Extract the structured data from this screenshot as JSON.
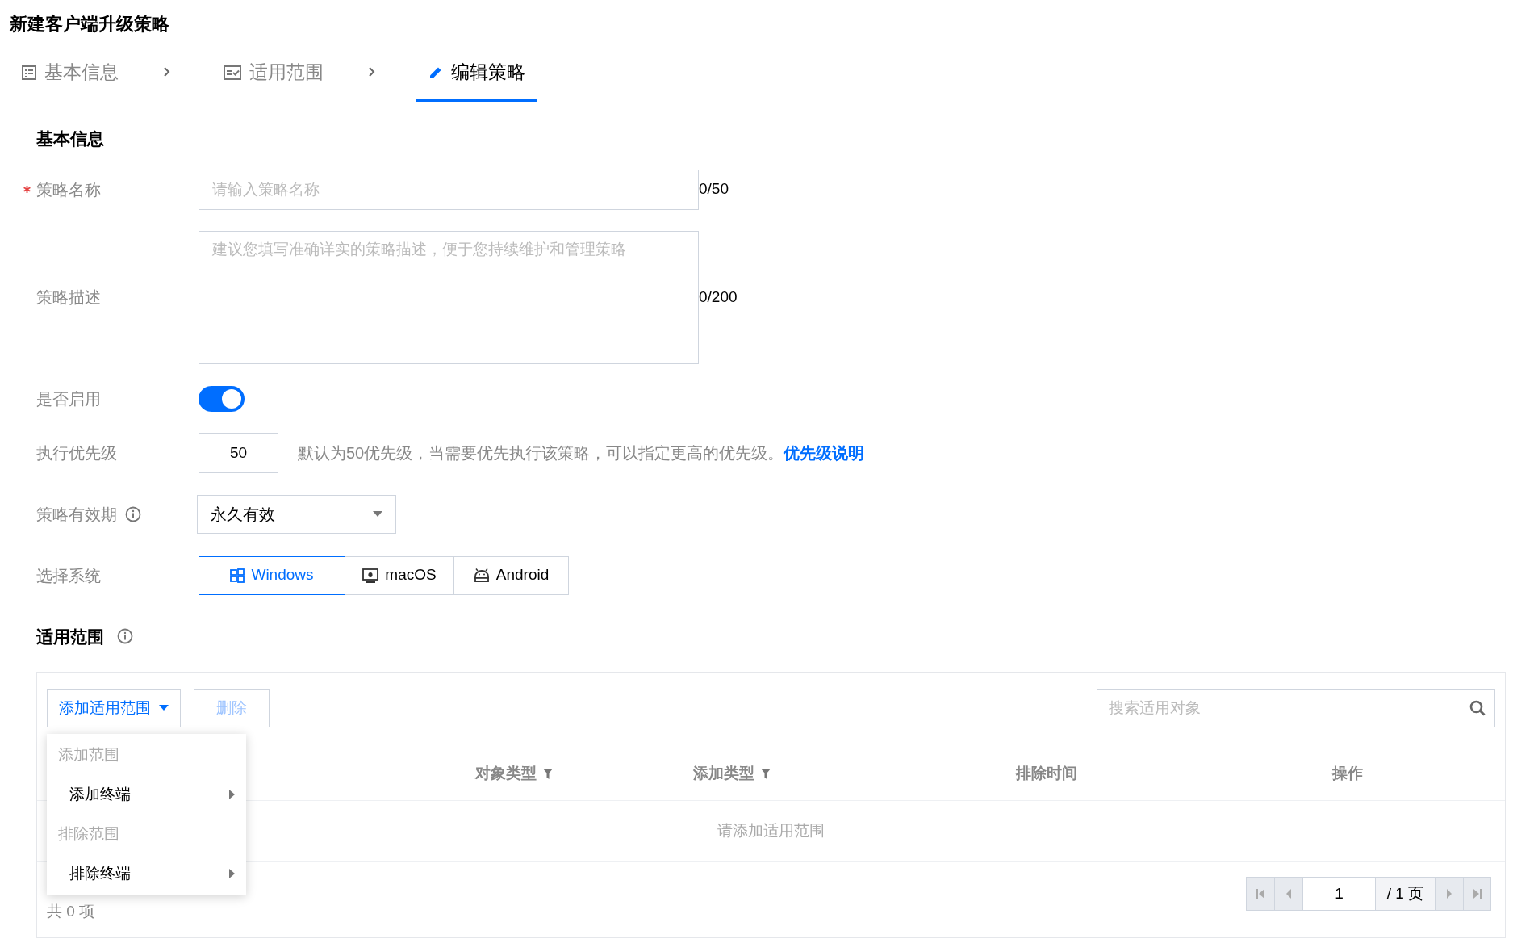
{
  "page_title": "新建客户端升级策略",
  "steps": [
    {
      "label": "基本信息",
      "selected": false
    },
    {
      "label": "适用范围",
      "selected": false
    },
    {
      "label": "编辑策略",
      "selected": true
    }
  ],
  "basic": {
    "section_title": "基本信息",
    "name": {
      "label": "策略名称",
      "required": true,
      "placeholder": "请输入策略名称",
      "counter": "0/50"
    },
    "description": {
      "label": "策略描述",
      "placeholder": "建议您填写准确详实的策略描述，便于您持续维护和管理策略",
      "counter": "0/200"
    },
    "enabled": {
      "label": "是否启用",
      "on": true
    },
    "priority": {
      "label": "执行优先级",
      "value": "50",
      "hint": "默认为50优先级，当需要优先执行该策略，可以指定更高的优先级。",
      "link": "优先级说明"
    },
    "validity": {
      "label": "策略有效期",
      "value": "永久有效"
    },
    "system": {
      "label": "选择系统",
      "options": [
        {
          "label": "Windows",
          "selected": true
        },
        {
          "label": "macOS",
          "selected": false
        },
        {
          "label": "Android",
          "selected": false
        }
      ]
    }
  },
  "scope": {
    "section_title": "适用范围",
    "add_button": "添加适用范围",
    "delete_button": {
      "label": "删除",
      "disabled": true
    },
    "search": {
      "placeholder": "搜索适用对象"
    },
    "columns": [
      "对象类型",
      "添加类型",
      "排除时间",
      "操作"
    ],
    "empty_text": "请添加适用范围",
    "total_text": "共 0 项",
    "pagination": {
      "page": "1",
      "total": "/ 1 页"
    },
    "menu": [
      {
        "kind": "group",
        "label": "添加范围"
      },
      {
        "kind": "item",
        "label": "添加终端"
      },
      {
        "kind": "group",
        "label": "排除范围"
      },
      {
        "kind": "item",
        "label": "排除终端"
      }
    ]
  }
}
